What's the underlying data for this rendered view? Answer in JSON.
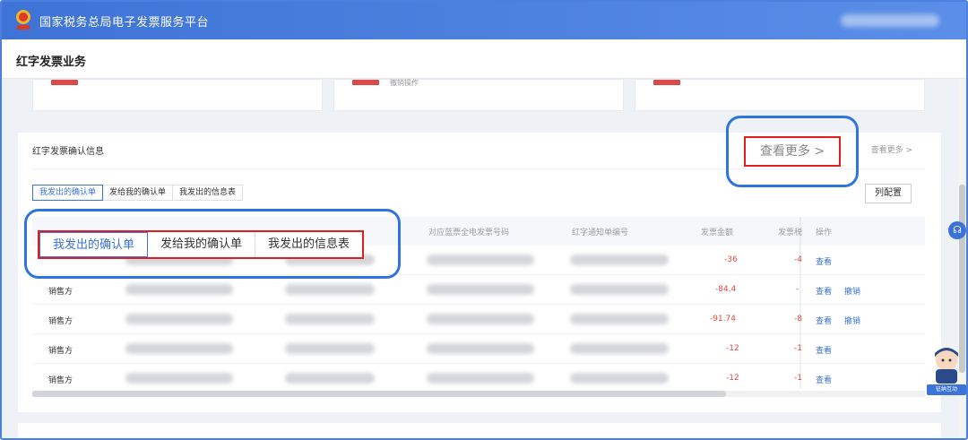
{
  "header": {
    "platform_title": "国家税务总局电子发票服务平台"
  },
  "page": {
    "title": "红字发票业务"
  },
  "top_cards": [
    {
      "text": ""
    },
    {
      "text": "撤销操作"
    },
    {
      "text": ""
    }
  ],
  "panel": {
    "title": "红字发票确认信息",
    "more_small": "查看更多 >",
    "more_big": "查看更多 >",
    "tabs": [
      {
        "label": "我发出的确认单",
        "active": true
      },
      {
        "label": "发给我的确认单",
        "active": false
      },
      {
        "label": "我发出的信息表",
        "active": false
      }
    ],
    "config_label": "列配置"
  },
  "table": {
    "headers": [
      "对应蓝票全电发票号码",
      "红字通知单编号",
      "发票金额",
      "发票税",
      "操作"
    ],
    "rows": [
      {
        "seller": "",
        "amount": "-36",
        "tax": "-4",
        "actions": [
          "查看"
        ]
      },
      {
        "seller": "销售方",
        "amount": "-84.4",
        "tax": "-",
        "actions": [
          "查看",
          "撤销"
        ]
      },
      {
        "seller": "销售方",
        "amount": "-91.74",
        "tax": "-8",
        "actions": [
          "查看",
          "撤销"
        ]
      },
      {
        "seller": "销售方",
        "amount": "-12",
        "tax": "-1",
        "actions": [
          "查看"
        ]
      },
      {
        "seller": "销售方",
        "amount": "-12",
        "tax": "-1",
        "actions": [
          "查看"
        ]
      }
    ]
  },
  "assistant": {
    "label": "征纳互动"
  },
  "colors": {
    "header_blue": "#3e73d6",
    "highlight_red": "#e01e1e",
    "circle_blue": "#2e74dc",
    "amount_red": "#e04848",
    "link_blue": "#3b73d8"
  }
}
